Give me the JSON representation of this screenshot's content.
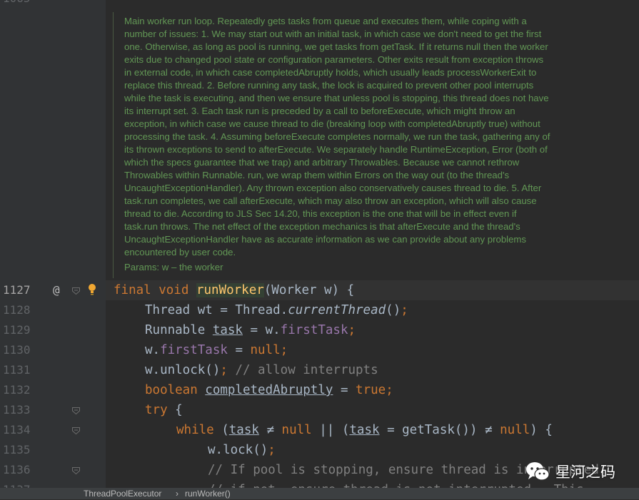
{
  "editor": {
    "top_partial_line_number": "1065",
    "javadoc": {
      "text": "Main worker run loop. Repeatedly gets tasks from queue and executes them, while coping with a number of issues: 1. We may start out with an initial task, in which case we don't need to get the first one. Otherwise, as long as pool is running, we get tasks from getTask. If it returns null then the worker exits due to changed pool state or configuration parameters. Other exits result from exception throws in external code, in which case completedAbruptly holds, which usually leads processWorkerExit to replace this thread. 2. Before running any task, the lock is acquired to prevent other pool interrupts while the task is executing, and then we ensure that unless pool is stopping, this thread does not have its interrupt set. 3. Each task run is preceded by a call to beforeExecute, which might throw an exception, in which case we cause thread to die (breaking loop with completedAbruptly true) without processing the task. 4. Assuming beforeExecute completes normally, we run the task, gathering any of its thrown exceptions to send to afterExecute. We separately handle RuntimeException, Error (both of which the specs guarantee that we trap) and arbitrary Throwables. Because we cannot rethrow Throwables within Runnable. run, we wrap them within Errors on the way out (to the thread's UncaughtExceptionHandler). Any thrown exception also conservatively causes thread to die. 5. After task.run completes, we call afterExecute, which may also throw an exception, which will also cause thread to die. According to JLS Sec 14.20, this exception is the one that will be in effect even if task.run throws. The net effect of the exception mechanics is that afterExecute and the thread's UncaughtExceptionHandler have as accurate information as we can provide about any problems encountered by user code.",
      "params": "Params: w – the worker"
    },
    "gutter_at": "@",
    "line_numbers": [
      "1127",
      "1128",
      "1129",
      "1130",
      "1131",
      "1132",
      "1133",
      "1134",
      "1135",
      "1136",
      "1137"
    ],
    "code": {
      "l1127": {
        "kw1": "final",
        "kw2": "void",
        "method": "runWorker",
        "params": "(Worker w) {"
      },
      "l1128": {
        "a": "Thread wt = Thread.",
        "call": "currentThread",
        "b": "()",
        "semi": ";"
      },
      "l1129": {
        "type": "Runnable ",
        "var": "task",
        "eq": " = w.",
        "field": "firstTask",
        "semi": ";"
      },
      "l1130": {
        "obj": "w.",
        "field": "firstTask",
        "eq": " = ",
        "kw": "null",
        "semi": ";"
      },
      "l1131": {
        "code": "w.unlock()",
        "semi": ";",
        "comment": " // allow interrupts"
      },
      "l1132": {
        "kw": "boolean ",
        "var": "completedAbruptly",
        "eq": " = ",
        "val": "true",
        "semi": ";"
      },
      "l1133": {
        "kw": "try",
        "rest": " {"
      },
      "l1134": {
        "kw": "while",
        "p1": " (",
        "v1": "task",
        "ne1": " ≠ ",
        "n1": "null",
        "or": " || (",
        "v2": "task",
        "mid": " = getTask()) ",
        "ne2": "≠ ",
        "n2": "null",
        "end": ") {"
      },
      "l1135": {
        "code": "w.lock()",
        "semi": ";"
      },
      "l1136": {
        "comment": "// If pool is stopping, ensure thread is interrupted;"
      },
      "l1137": {
        "comment": "// if not, ensure thread is not interrupted.  This"
      }
    }
  },
  "breadcrumb": {
    "class": "ThreadPoolExecutor",
    "sep": "›",
    "method": "runWorker()"
  },
  "watermark": {
    "text": "星河之码",
    "icon": "wechat-icon"
  },
  "colors": {
    "keyword": "#cc7832",
    "method": "#ffc66d",
    "field": "#9876aa",
    "comment": "#808080",
    "doc": "#629755",
    "text": "#a9b7c6"
  }
}
